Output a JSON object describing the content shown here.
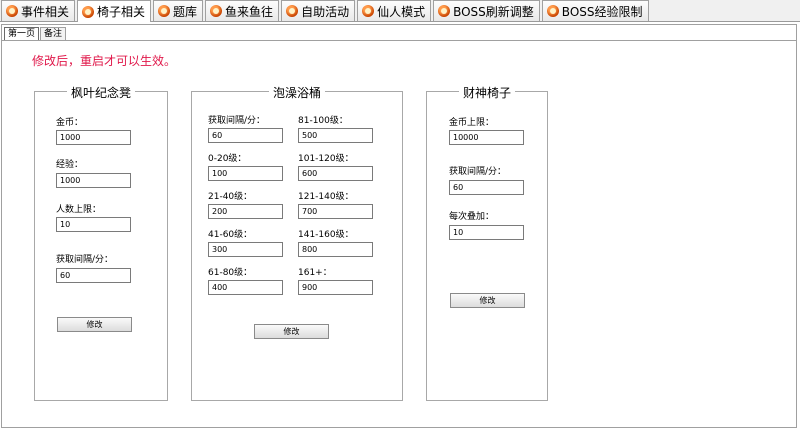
{
  "top_tabs": [
    {
      "label": "事件相关"
    },
    {
      "label": "椅子相关"
    },
    {
      "label": "题库"
    },
    {
      "label": "鱼来鱼往"
    },
    {
      "label": "自助活动"
    },
    {
      "label": "仙人模式"
    },
    {
      "label": "BOSS刷新调整"
    },
    {
      "label": "BOSS经验限制"
    }
  ],
  "inner_tabs": [
    {
      "label": "第一页"
    },
    {
      "label": "备注"
    }
  ],
  "notice": "修改后，重启才可以生效。",
  "panels": {
    "maple": {
      "title": "枫叶纪念凳",
      "gold_label": "金币：",
      "gold_value": "1000",
      "exp_label": "经验：",
      "exp_value": "1000",
      "limit_label": "人数上限：",
      "limit_value": "10",
      "interval_label": "获取间隔/分：",
      "interval_value": "60",
      "modify_label": "修改"
    },
    "bath": {
      "title": "泡澡浴桶",
      "interval_label": "获取间隔/分：",
      "interval_value": "60",
      "l0_20_label": "0-20级：",
      "l0_20_value": "100",
      "l21_40_label": "21-40级：",
      "l21_40_value": "200",
      "l41_60_label": "41-60级：",
      "l41_60_value": "300",
      "l61_80_label": "61-80级：",
      "l61_80_value": "400",
      "l81_100_label": "81-100级：",
      "l81_100_value": "500",
      "l101_120_label": "101-120级：",
      "l101_120_value": "600",
      "l121_140_label": "121-140级：",
      "l121_140_value": "700",
      "l141_160_label": "141-160级：",
      "l141_160_value": "800",
      "l161_label": "161+：",
      "l161_value": "900",
      "modify_label": "修改"
    },
    "fortune": {
      "title": "财神椅子",
      "gold_label": "金币上限：",
      "gold_value": "10000",
      "interval_label": "获取间隔/分：",
      "interval_value": "60",
      "stack_label": "每次叠加：",
      "stack_value": "10",
      "modify_label": "修改"
    }
  }
}
